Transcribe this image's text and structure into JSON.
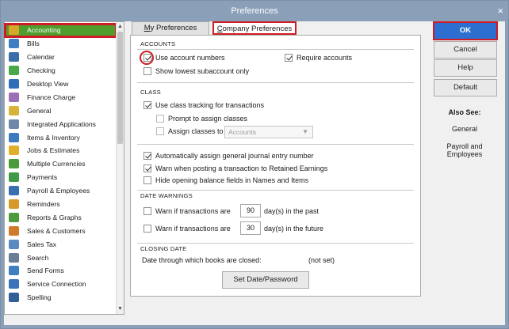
{
  "window": {
    "title": "Preferences",
    "close_glyph": "×"
  },
  "sidebar": {
    "items": [
      {
        "label": "Accounting",
        "icon": "accounting-icon",
        "color": "#d7a72b"
      },
      {
        "label": "Bills",
        "icon": "bills-icon",
        "color": "#3d7fc1"
      },
      {
        "label": "Calendar",
        "icon": "calendar-icon",
        "color": "#3a6ea8"
      },
      {
        "label": "Checking",
        "icon": "checking-icon",
        "color": "#4aa84a"
      },
      {
        "label": "Desktop View",
        "icon": "desktop-view-icon",
        "color": "#2f6fb8"
      },
      {
        "label": "Finance Charge",
        "icon": "finance-charge-icon",
        "color": "#9a6fb5"
      },
      {
        "label": "General",
        "icon": "general-icon",
        "color": "#d8b33a"
      },
      {
        "label": "Integrated Applications",
        "icon": "integrated-applications-icon",
        "color": "#6f87a8"
      },
      {
        "label": "Items & Inventory",
        "icon": "items-inventory-icon",
        "color": "#3b7cc0"
      },
      {
        "label": "Jobs & Estimates",
        "icon": "jobs-estimates-icon",
        "color": "#e0b02b"
      },
      {
        "label": "Multiple Currencies",
        "icon": "multiple-currencies-icon",
        "color": "#4d9a3a"
      },
      {
        "label": "Payments",
        "icon": "payments-icon",
        "color": "#3f9a47"
      },
      {
        "label": "Payroll & Employees",
        "icon": "payroll-employees-icon",
        "color": "#3a6fb0"
      },
      {
        "label": "Reminders",
        "icon": "reminders-icon",
        "color": "#d79a2a"
      },
      {
        "label": "Reports & Graphs",
        "icon": "reports-graphs-icon",
        "color": "#4f9a3c"
      },
      {
        "label": "Sales & Customers",
        "icon": "sales-customers-icon",
        "color": "#d07a2a"
      },
      {
        "label": "Sales Tax",
        "icon": "sales-tax-icon",
        "color": "#5a8ac0"
      },
      {
        "label": "Search",
        "icon": "search-icon",
        "color": "#6a7e95"
      },
      {
        "label": "Send Forms",
        "icon": "send-forms-icon",
        "color": "#3d7fc1"
      },
      {
        "label": "Service Connection",
        "icon": "service-connection-icon",
        "color": "#3a74b8"
      },
      {
        "label": "Spelling",
        "icon": "spelling-icon",
        "color": "#2f5f98"
      }
    ],
    "scroll_up": "▲",
    "scroll_down": "▼"
  },
  "tabs": {
    "my_preferences": {
      "accel": "M",
      "rest": "y Preferences"
    },
    "company_preferences": {
      "accel": "C",
      "rest": "ompany Preferences"
    }
  },
  "accounts": {
    "title": "ACCOUNTS",
    "use_account_numbers": {
      "label": "Use account numbers",
      "checked": true
    },
    "require_accounts": {
      "label": "Require accounts",
      "checked": true
    },
    "show_lowest_subaccount": {
      "label": "Show lowest subaccount only",
      "checked": false
    }
  },
  "class": {
    "title": "CLASS",
    "use_class_tracking": {
      "label": "Use class tracking for transactions",
      "checked": true
    },
    "prompt_to_assign": {
      "label": "Prompt to assign classes",
      "checked": false
    },
    "assign_classes_to": {
      "label": "Assign classes to",
      "checked": false
    },
    "assign_select_value": "Accounts",
    "select_arrow": "▼"
  },
  "general_options": {
    "auto_journal_number": {
      "label": "Automatically assign general journal entry number",
      "checked": true
    },
    "warn_retained_earnings": {
      "label": "Warn when posting a transaction to Retained Earnings",
      "checked": true
    },
    "hide_opening_balance": {
      "label": "Hide opening balance fields in Names and Items",
      "checked": false
    }
  },
  "date_warnings": {
    "title": "DATE WARNINGS",
    "past": {
      "label": "Warn if transactions are",
      "days": "90",
      "suffix": "day(s) in the past",
      "checked": false
    },
    "future": {
      "label": "Warn if transactions are",
      "days": "30",
      "suffix": "day(s) in the future",
      "checked": false
    }
  },
  "closing_date": {
    "title": "CLOSING DATE",
    "label": "Date through which books are closed:",
    "value": "(not set)",
    "button": "Set Date/Password"
  },
  "buttons": {
    "ok": "OK",
    "cancel": "Cancel",
    "help": "Help",
    "default": "Default"
  },
  "also_see": {
    "title": "Also See:",
    "links": [
      "General",
      "Payroll and Employees"
    ]
  },
  "colors": {
    "selected_item": "#4f9e2c",
    "highlight_red": "#d01c24",
    "ok_blue": "#2d6fd1",
    "titlebar": "#8a9fb8"
  }
}
